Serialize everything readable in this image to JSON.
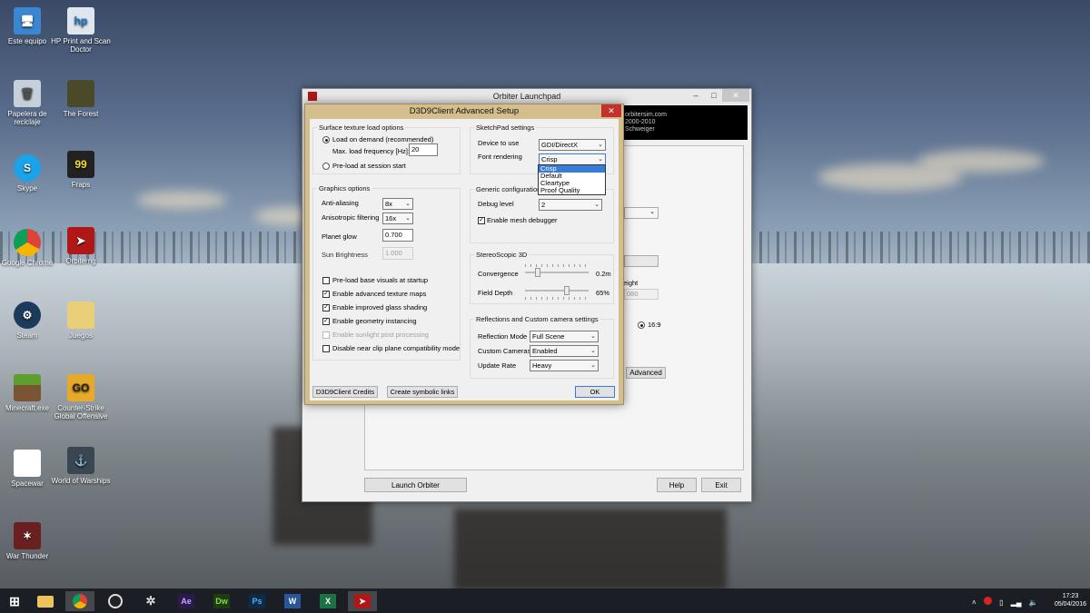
{
  "desktop": {
    "icons": [
      {
        "label": "Este equipo",
        "icon": "computer-icon"
      },
      {
        "label": "HP Print and Scan Doctor",
        "icon": "hp-icon"
      },
      {
        "label": "Papelera de reciclaje",
        "icon": "recycle-bin-icon"
      },
      {
        "label": "The Forest",
        "icon": "the-forest-icon"
      },
      {
        "label": "Skype",
        "icon": "skype-icon"
      },
      {
        "label": "Fraps",
        "icon": "fraps-icon"
      },
      {
        "label": "Google Chrome",
        "icon": "chrome-icon"
      },
      {
        "label": "Orbiterng",
        "icon": "orbiter-icon"
      },
      {
        "label": "Steam",
        "icon": "steam-icon"
      },
      {
        "label": "Juegos",
        "icon": "folder-icon"
      },
      {
        "label": "Minecraft.exe",
        "icon": "minecraft-icon"
      },
      {
        "label": "Counter-Strike Global Offensive",
        "icon": "csgo-icon"
      },
      {
        "label": "Spacewar",
        "icon": "file-icon"
      },
      {
        "label": "World of Warships",
        "icon": "warships-icon"
      },
      {
        "label": "War Thunder",
        "icon": "war-thunder-icon"
      }
    ]
  },
  "launchpad": {
    "title": "Orbiter Launchpad",
    "banner_line1": "orbitersim.com",
    "banner_line2": "2000-2010",
    "banner_line3": "Schweiger",
    "partial_eight": "eight",
    "partial_080": "080",
    "ratio_169": "16:9",
    "advanced_button": "Advanced",
    "launch_button": "Launch Orbiter",
    "help_button": "Help",
    "exit_button": "Exit"
  },
  "dialog": {
    "title": "D3D9Client Advanced Setup",
    "close": "✕",
    "surface": {
      "group": "Surface texture load options",
      "load_on_demand": "Load on demand (recommended)",
      "max_freq_label": "Max. load frequency [Hz]:",
      "max_freq_value": "20",
      "preload": "Pre-load at session start"
    },
    "graphics": {
      "group": "Graphics options",
      "anti_aliasing_label": "Anti-aliasing",
      "anti_aliasing_value": "8x",
      "anisotropic_label": "Anisotropic filtering",
      "anisotropic_value": "16x",
      "planet_glow_label": "Planet glow",
      "planet_glow_value": "0.700",
      "sun_brightness_label": "Sun Brightness",
      "sun_brightness_value": "1.000",
      "checks": [
        {
          "label": "Pre-load base visuals at startup",
          "checked": false,
          "enabled": true
        },
        {
          "label": "Enable advanced texture maps",
          "checked": true,
          "enabled": true
        },
        {
          "label": "Enable improved glass shading",
          "checked": true,
          "enabled": true
        },
        {
          "label": "Enable geometry instancing",
          "checked": true,
          "enabled": true
        },
        {
          "label": "Enable sunlight post processing",
          "checked": false,
          "enabled": false
        },
        {
          "label": "Disable near clip plane compatibility mode",
          "checked": false,
          "enabled": true
        }
      ]
    },
    "sketchpad": {
      "group": "SketchPad settings",
      "device_label": "Device to use",
      "device_value": "GDI/DirectX",
      "font_label": "Font rendering",
      "font_value": "Crisp",
      "font_options": [
        "Crisp",
        "Default",
        "Cleartype",
        "Proof Quality"
      ]
    },
    "generic": {
      "group": "Generic configuration",
      "debug_label": "Debug level",
      "debug_value": "2",
      "mesh_debugger": "Enable mesh debugger"
    },
    "stereo": {
      "group": "StereoScopic 3D",
      "convergence_label": "Convergence",
      "convergence_value": "0.2m",
      "field_depth_label": "Field Depth",
      "field_depth_value": "65%",
      "convergence_level": 0.2,
      "field_depth_level": 0.65
    },
    "reflections": {
      "group": "Reflections and Custom camera settings",
      "mode_label": "Reflection Mode",
      "mode_value": "Full Scene",
      "cameras_label": "Custom Cameras",
      "cameras_value": "Enabled",
      "rate_label": "Update Rate",
      "rate_value": "Heavy"
    },
    "credits_button": "D3D9Client Credits",
    "symlinks_button": "Create symbolic links",
    "ok_button": "OK"
  },
  "taskbar": {
    "apps": [
      "start-icon",
      "file-explorer-icon",
      "chrome-icon",
      "obs-icon",
      "orbiter-tools-icon",
      "after-effects-icon",
      "dreamweaver-icon",
      "photoshop-icon",
      "word-icon",
      "excel-icon",
      "orbiter-icon"
    ],
    "app_labels": [
      "",
      "",
      "",
      "",
      "",
      "Ae",
      "Dw",
      "Ps",
      "W",
      "X",
      ""
    ],
    "time": "17:23",
    "date": "05/04/2016"
  }
}
